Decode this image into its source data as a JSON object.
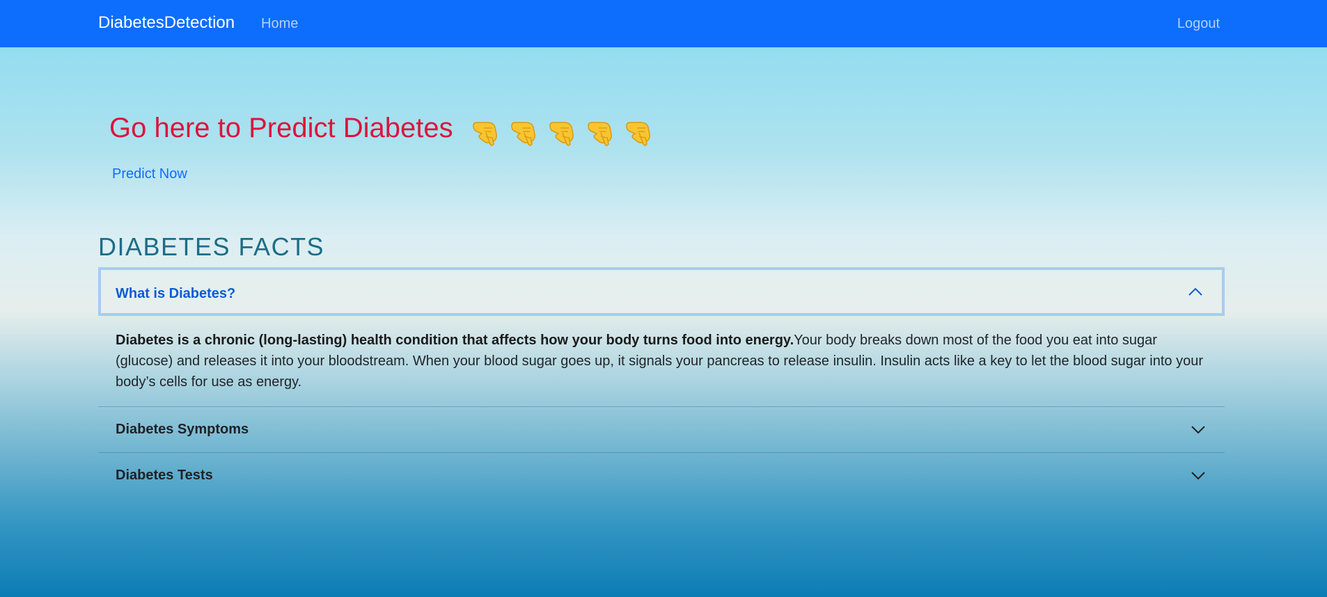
{
  "navbar": {
    "brand": "DiabetesDetection",
    "home": "Home",
    "logout": "Logout"
  },
  "hero": {
    "title": "Go here to Predict Diabetes",
    "hand_icon": "pointing-down-hand-icon",
    "hand_count": 5,
    "predict_link": "Predict Now"
  },
  "facts": {
    "title": "DIABETES FACTS",
    "items": [
      {
        "label": "What is Diabetes?",
        "expanded": true,
        "body_bold": "Diabetes is a chronic (long-lasting) health condition that affects how your body turns food into energy.",
        "body_text": "Your body breaks down most of the food you eat into sugar (glucose) and releases it into your bloodstream. When your blood sugar goes up, it signals your pancreas to release insulin. Insulin acts like a key to let the blood sugar into your body’s cells for use as energy."
      },
      {
        "label": "Diabetes Symptoms",
        "expanded": false
      },
      {
        "label": "Diabetes Tests",
        "expanded": false
      }
    ]
  },
  "colors": {
    "navbar": "#0d6efd",
    "hero_title": "#dc143c",
    "link": "#0d6efd",
    "facts_title": "#1c6d86",
    "active_header": "#0c5bd6"
  }
}
